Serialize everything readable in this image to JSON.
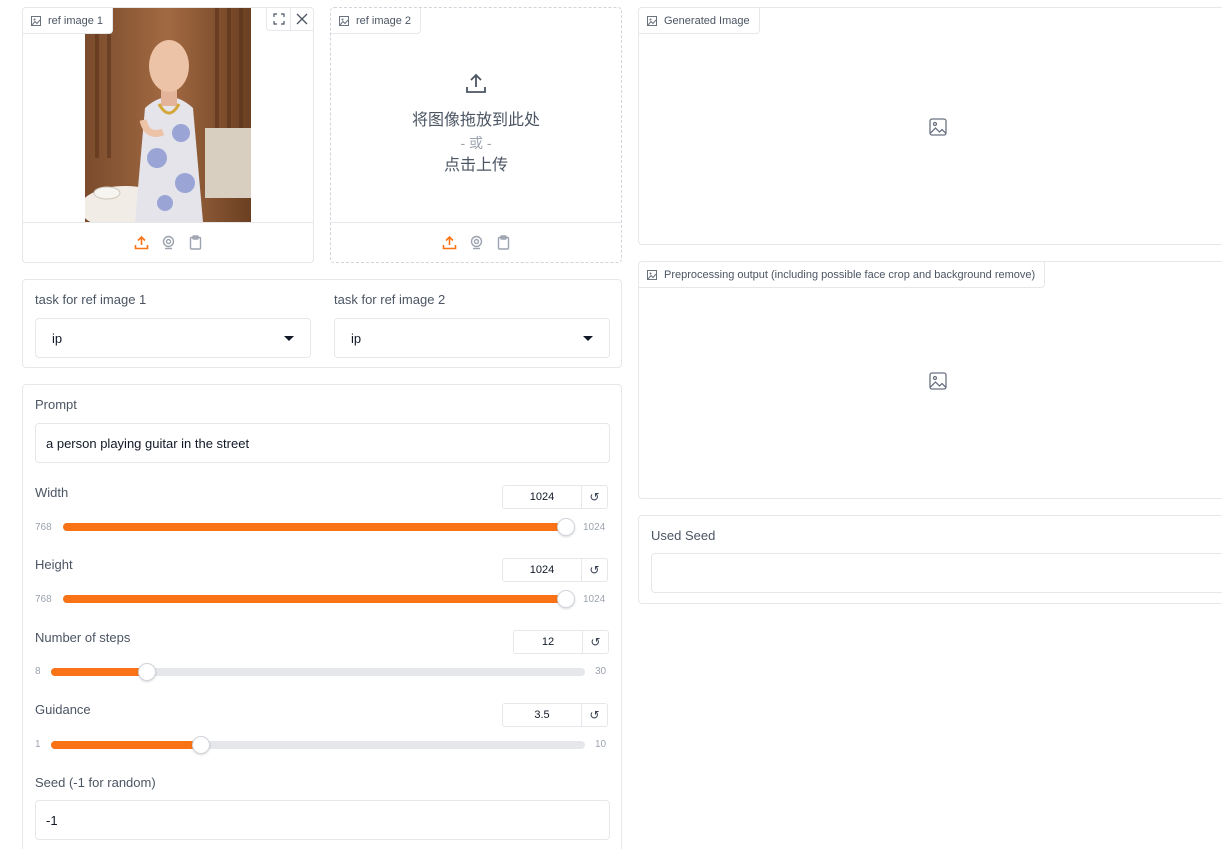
{
  "ref_image_1": {
    "label": "ref image 1",
    "icon": "image-icon",
    "has_image": true
  },
  "ref_image_2": {
    "label": "ref image 2",
    "drop_text": "将图像拖放到此处",
    "or_text": "- 或 -",
    "click_text": "点击上传"
  },
  "source_icons": [
    "upload-icon",
    "webcam-icon",
    "clipboard-icon"
  ],
  "tasks": {
    "task1": {
      "label": "task for ref image 1",
      "value": "ip"
    },
    "task2": {
      "label": "task for ref image 2",
      "value": "ip"
    }
  },
  "prompt": {
    "label": "Prompt",
    "value": "a person playing guitar in the street"
  },
  "width": {
    "label": "Width",
    "value": "1024",
    "min": "768",
    "max": "1024",
    "fraction": 1.0
  },
  "height": {
    "label": "Height",
    "value": "1024",
    "min": "768",
    "max": "1024",
    "fraction": 1.0
  },
  "steps": {
    "label": "Number of steps",
    "value": "12",
    "min": "8",
    "max": "30",
    "fraction": 0.18
  },
  "guidance": {
    "label": "Guidance",
    "value": "3.5",
    "min": "1",
    "max": "10",
    "fraction": 0.28
  },
  "seed": {
    "label": "Seed (-1 for random)",
    "value": "-1"
  },
  "reset_symbol": "↺",
  "outputs": {
    "generated": {
      "label": "Generated Image"
    },
    "preprocessing": {
      "label": "Preprocessing output (including possible face crop and background remove)"
    },
    "used_seed": {
      "label": "Used Seed",
      "value": ""
    }
  },
  "colors": {
    "accent": "#f97316",
    "border": "#e5e7eb",
    "track": "#e5e7eb"
  }
}
